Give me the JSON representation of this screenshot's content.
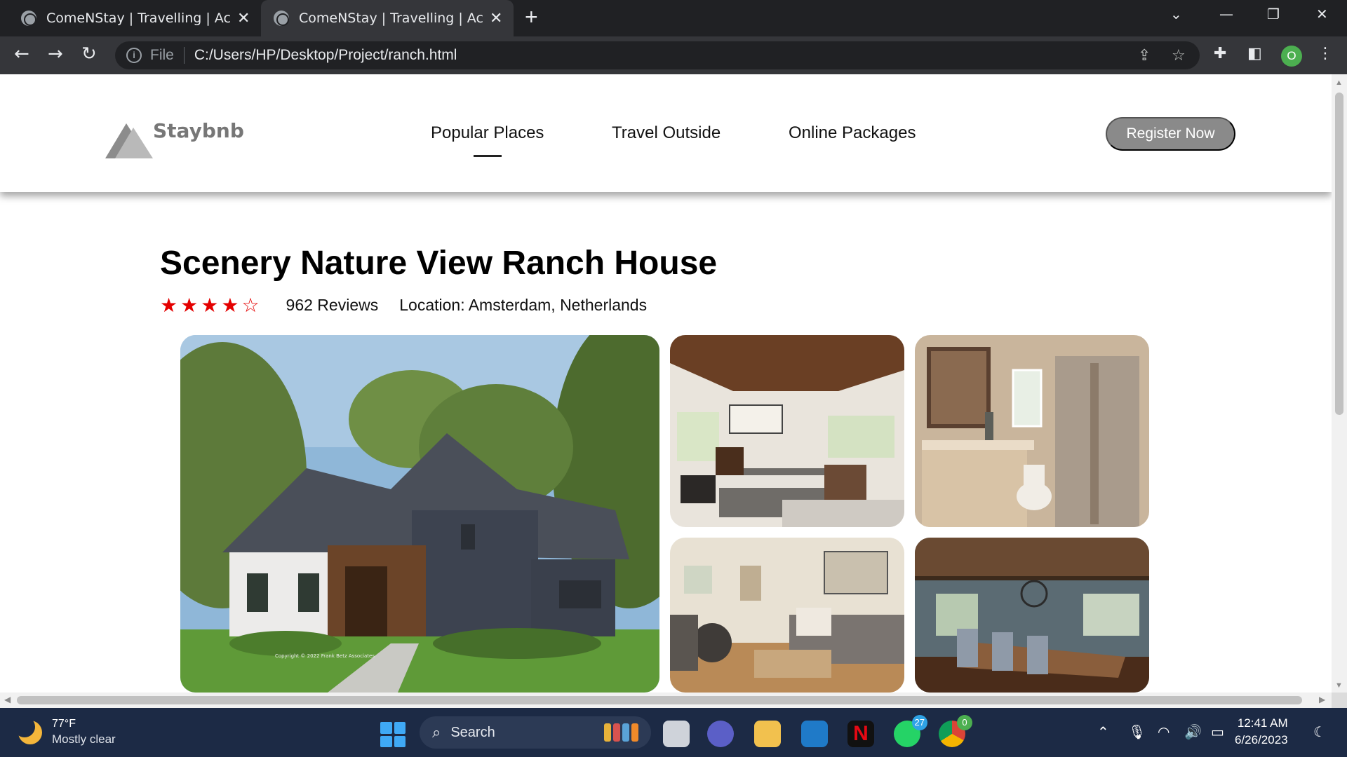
{
  "browser": {
    "tabs": [
      {
        "title": "ComeNStay | Travelling | Accommodation"
      },
      {
        "title": "ComeNStay | Travelling | Accommodation"
      }
    ],
    "address": {
      "scheme_label": "File",
      "url": "C:/Users/HP/Desktop/Project/ranch.html"
    },
    "profile_initial": "O"
  },
  "site": {
    "logo_text": "Staybnb",
    "nav": [
      {
        "label": "Popular Places"
      },
      {
        "label": "Travel Outside"
      },
      {
        "label": "Online Packages"
      }
    ],
    "cta_label": "Register Now"
  },
  "listing": {
    "title": "Scenery Nature View Ranch House",
    "rating": 4,
    "rating_max": 5,
    "reviews": "962 Reviews",
    "location": "Location: Amsterdam, Netherlands",
    "photo_caption": "Copyright © 2022 Frank Betz Associates"
  },
  "taskbar": {
    "weather_temp": "77°F",
    "weather_desc": "Mostly clear",
    "search_label": "Search",
    "whatsapp_badge": "27",
    "chrome_badge": "0",
    "time": "12:41 AM",
    "date": "6/26/2023"
  },
  "colors": {
    "star": "#e40000",
    "cta_bg": "#8a8a8a",
    "chrome_dark": "#202124",
    "taskbar": "#1c2a45"
  }
}
